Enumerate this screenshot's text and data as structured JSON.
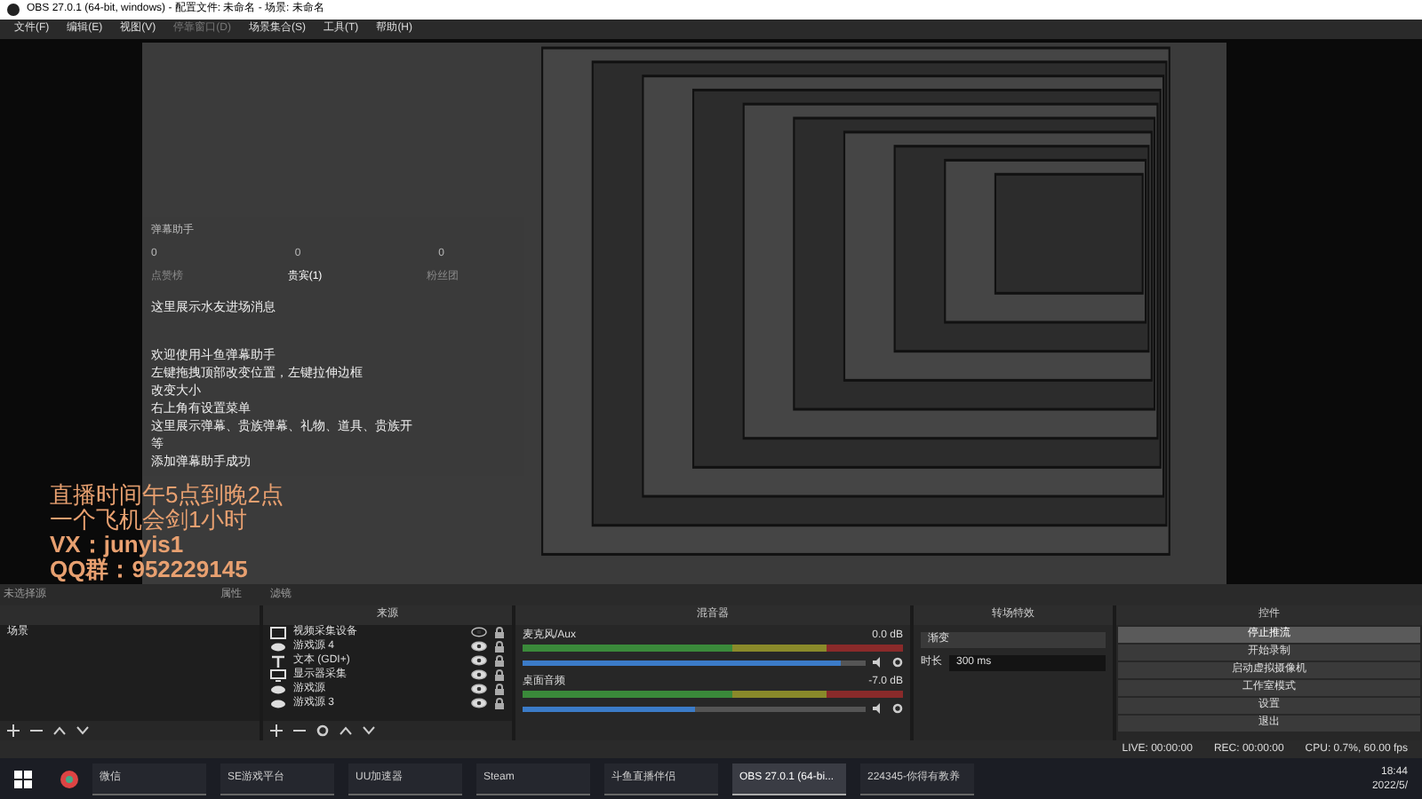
{
  "window": {
    "title": "OBS 27.0.1 (64-bit, windows) - 配置文件: 未命名 - 场景: 未命名"
  },
  "menu": [
    {
      "label": "文件(F)",
      "disabled": false
    },
    {
      "label": "编辑(E)",
      "disabled": false
    },
    {
      "label": "视图(V)",
      "disabled": false
    },
    {
      "label": "停靠窗口(D)",
      "disabled": true
    },
    {
      "label": "场景集合(S)",
      "disabled": false
    },
    {
      "label": "工具(T)",
      "disabled": false
    },
    {
      "label": "帮助(H)",
      "disabled": false
    }
  ],
  "danmaku": {
    "title": "弹幕助手",
    "counts": [
      "0",
      "0",
      "0"
    ],
    "tabs": [
      {
        "label": "点赞榜",
        "selected": false
      },
      {
        "label": "贵宾(1)",
        "selected": true
      },
      {
        "label": "粉丝团",
        "selected": false
      }
    ],
    "entry_message": "这里展示水友进场消息",
    "messages": [
      "欢迎使用斗鱼弹幕助手",
      "左键拖拽顶部改变位置，左键拉伸边框",
      "改变大小",
      "右上角有设置菜单",
      "这里展示弹幕、贵族弹幕、礼物、道具、贵族开",
      "等",
      "添加弹幕助手成功"
    ]
  },
  "overlay_lines": [
    "直播时间午5点到晚2点",
    "一个飞机会剑1小时",
    "VX：junyis1",
    "QQ群：952229145"
  ],
  "toolbar": {
    "no_source": "未选择源",
    "buttons": [
      "属性",
      "滤镜"
    ]
  },
  "scenes": {
    "items": [
      {
        "label": "场景",
        "selected": false
      }
    ]
  },
  "sources": {
    "title": "来源",
    "items": [
      {
        "kind": "camera",
        "label": "视频采集设备",
        "visible": false
      },
      {
        "kind": "game",
        "label": "游戏源 4",
        "visible": true
      },
      {
        "kind": "text",
        "label": "文本 (GDI+)",
        "visible": true
      },
      {
        "kind": "monitor",
        "label": "显示器采集",
        "visible": true
      },
      {
        "kind": "game",
        "label": "游戏源",
        "visible": true
      },
      {
        "kind": "game",
        "label": "游戏源 3",
        "visible": true
      }
    ]
  },
  "mixer": {
    "title": "混音器",
    "channels": [
      {
        "name": "麦克风/Aux",
        "reading": "0.0 dB",
        "level": 0.93
      },
      {
        "name": "桌面音频",
        "reading": "-7.0 dB",
        "level": 0.5
      }
    ]
  },
  "transitions": {
    "title": "转场特效",
    "type": "渐变",
    "duration_label": "时长",
    "duration": "300 ms"
  },
  "controls": {
    "title": "控件",
    "buttons": [
      {
        "label": "停止推流",
        "selected": true
      },
      {
        "label": "开始录制",
        "selected": false
      },
      {
        "label": "启动虚拟摄像机",
        "selected": false
      },
      {
        "label": "工作室模式",
        "selected": false
      },
      {
        "label": "设置",
        "selected": false
      },
      {
        "label": "退出",
        "selected": false
      }
    ]
  },
  "status_bar": [
    "LIVE: 00:00:00",
    "REC: 00:00:00",
    "CPU: 0.7%, 60.00 fps"
  ],
  "taskbar": {
    "apps": [
      {
        "label": "微信",
        "selected": false
      },
      {
        "label": "SE游戏平台",
        "selected": false
      },
      {
        "label": "UU加速器",
        "selected": false
      },
      {
        "label": "Steam",
        "selected": false
      },
      {
        "label": "斗鱼直播伴侣",
        "selected": false
      },
      {
        "label": "OBS 27.0.1 (64-bi...",
        "selected": true
      },
      {
        "label": "224345-你得有教养",
        "selected": false
      }
    ],
    "time": "18:44",
    "date": "2022/5/"
  }
}
